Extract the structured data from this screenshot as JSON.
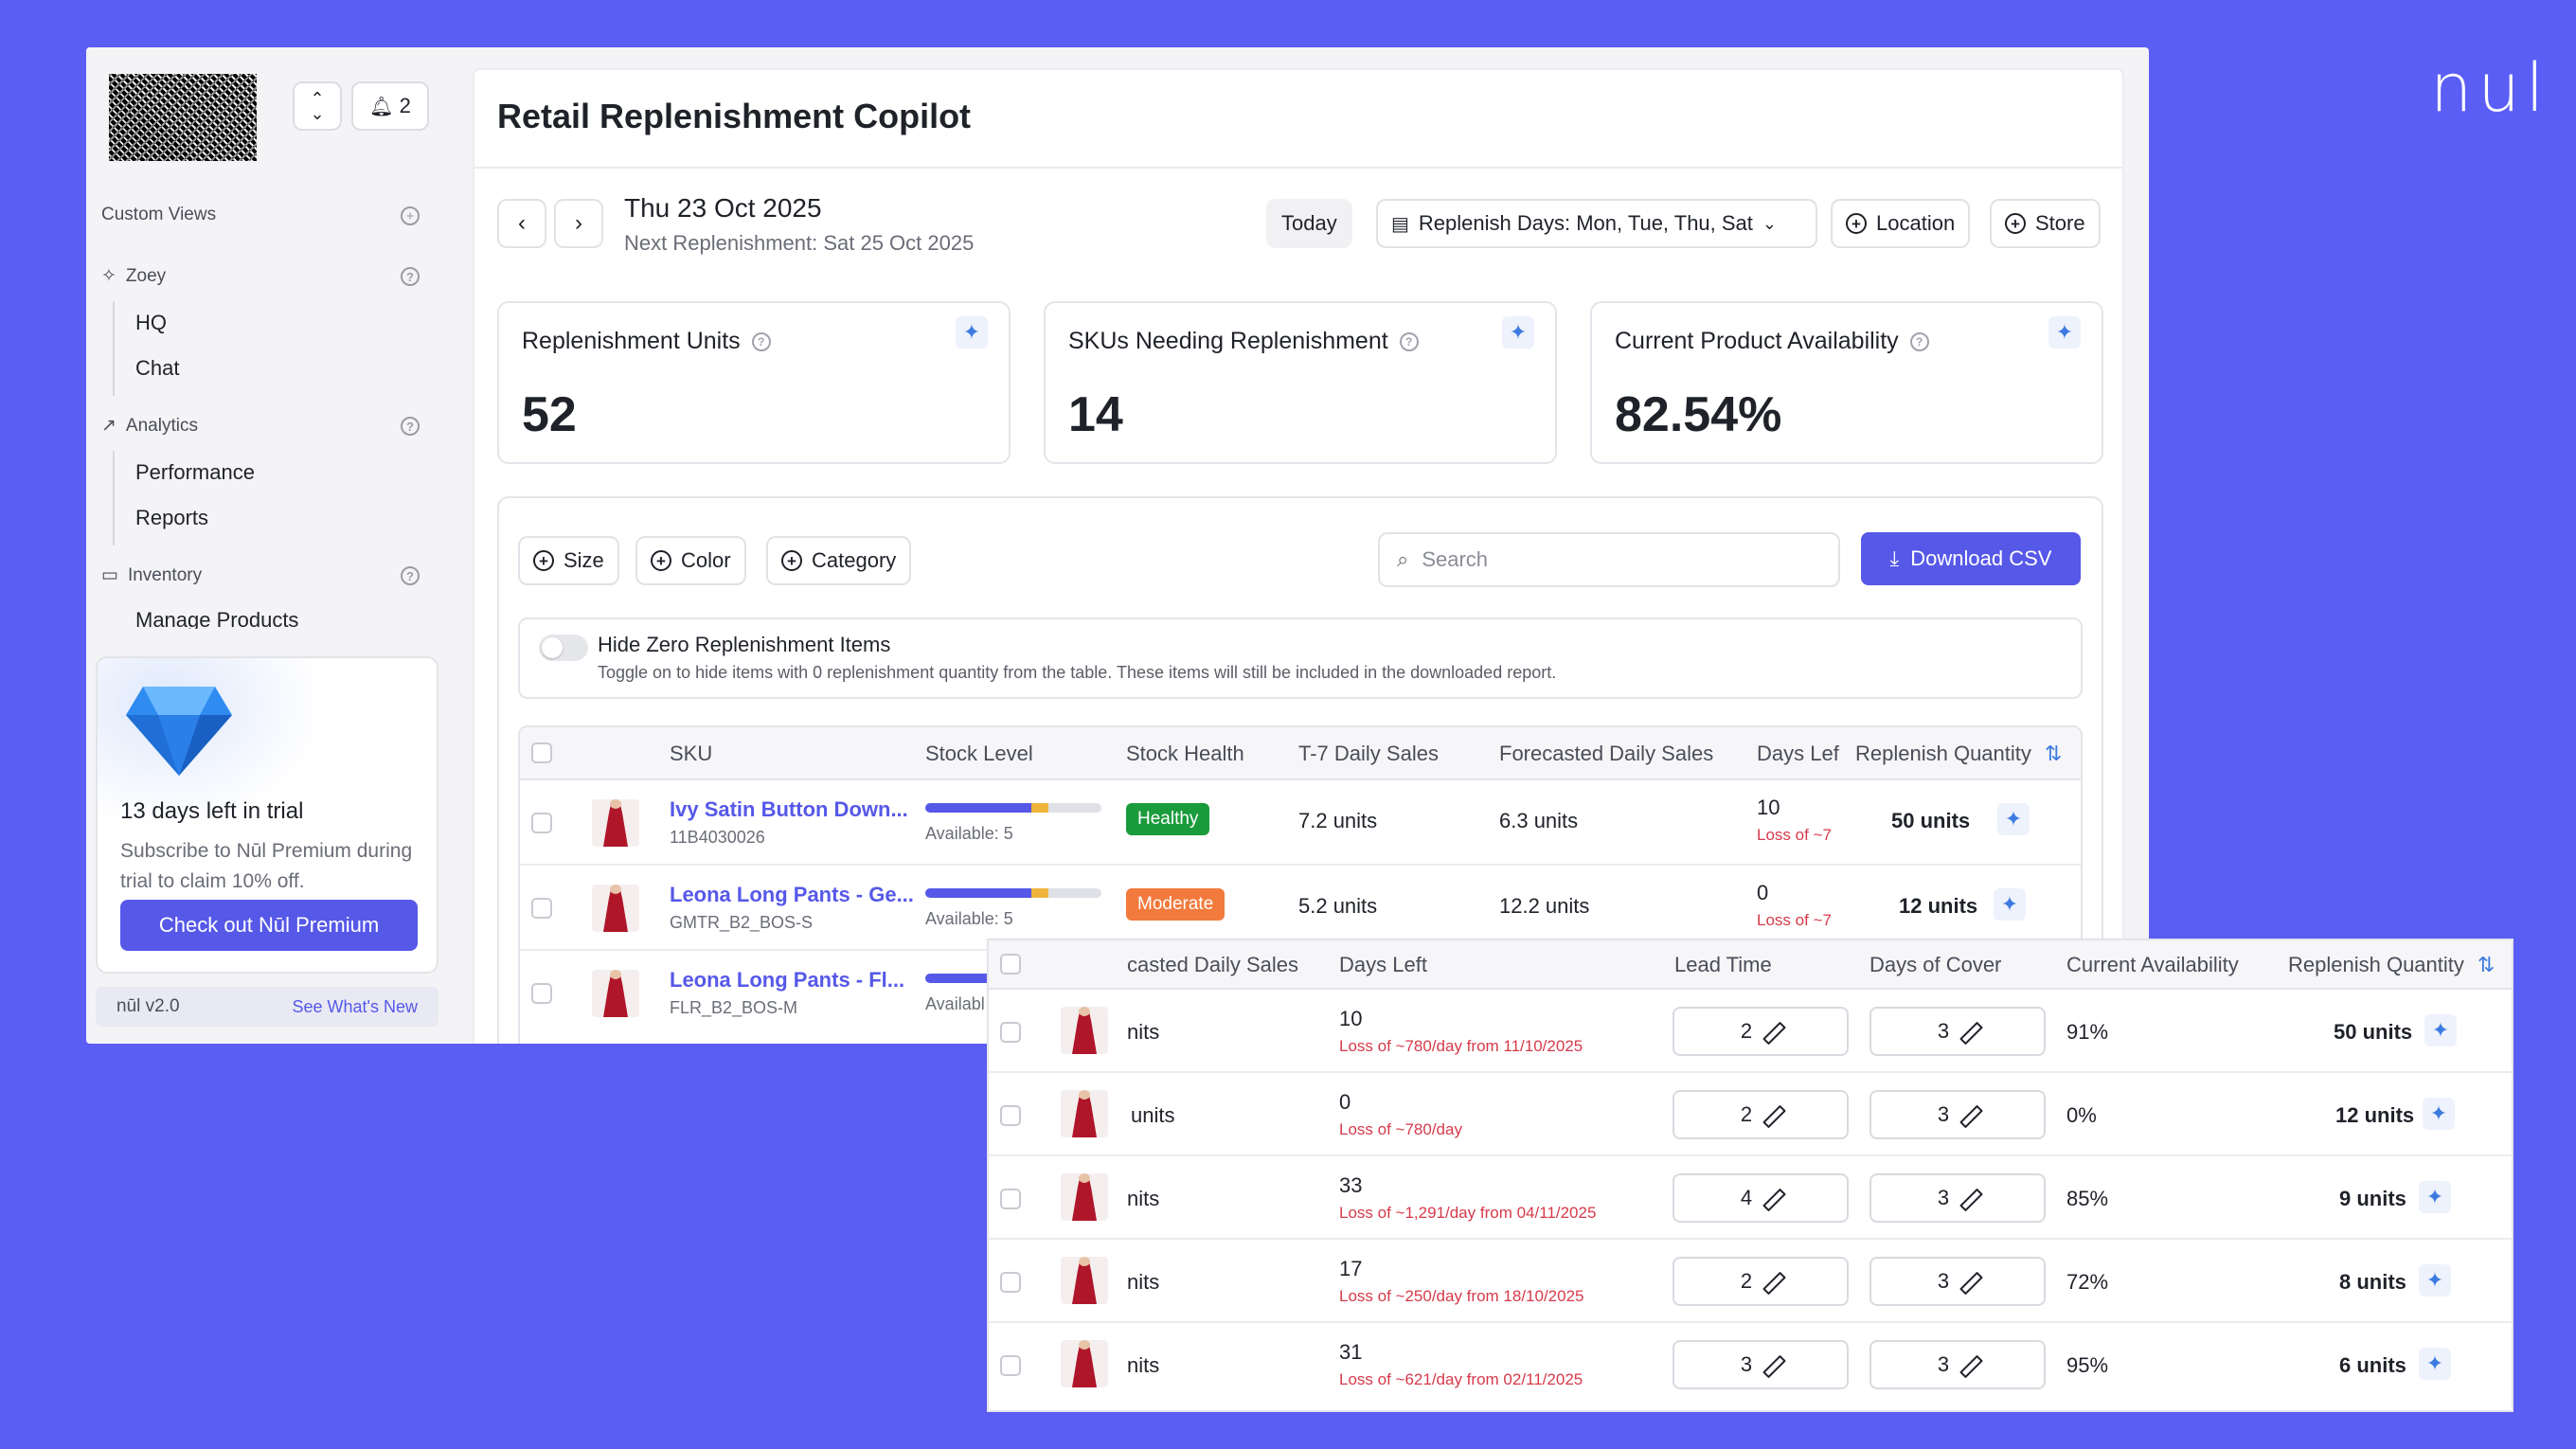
{
  "brand_mark": "nul",
  "sidebar": {
    "notification_count": "2",
    "custom_views_label": "Custom Views",
    "groups": [
      {
        "label": "Zoey",
        "items": [
          "HQ",
          "Chat"
        ]
      },
      {
        "label": "Analytics",
        "items": [
          "Performance",
          "Reports"
        ]
      },
      {
        "label": "Inventory",
        "items": [
          "Manage Products"
        ]
      }
    ],
    "trial": {
      "title": "13 days left in trial",
      "text": "Subscribe to Nūl Premium during trial to claim 10% off.",
      "button": "Check out Nūl Premium"
    },
    "version": "nūl v2.0",
    "whats_new": "See What's New"
  },
  "header": {
    "title": "Retail Replenishment Copilot",
    "date": "Thu 23 Oct 2025",
    "next_replenishment": "Next Replenishment: Sat 25 Oct 2025",
    "today_label": "Today",
    "replenish_days": "Replenish Days: Mon, Tue, Thu, Sat",
    "location_label": "Location",
    "store_label": "Store"
  },
  "kpis": [
    {
      "title": "Replenishment Units",
      "value": "52"
    },
    {
      "title": "SKUs Needing Replenishment",
      "value": "14"
    },
    {
      "title": "Current Product Availability",
      "value": "82.54%"
    }
  ],
  "filters": {
    "size": "Size",
    "color": "Color",
    "category": "Category",
    "search_placeholder": "Search",
    "download": "Download CSV"
  },
  "toggle": {
    "title": "Hide Zero Replenishment Items",
    "description": "Toggle on to hide items with 0 replenishment quantity from the table. These items will still be included in the downloaded report."
  },
  "table": {
    "columns": [
      "SKU",
      "Stock Level",
      "Stock Health",
      "T-7 Daily Sales",
      "Forecasted Daily Sales",
      "Days Lef",
      "Replenish Quantity"
    ],
    "rows": [
      {
        "name": "Ivy Satin Button Down...",
        "code": "11B4030026",
        "available": "Available: 5",
        "stock_level": 0.7,
        "health": "Healthy",
        "health_color": "#1a9b3c",
        "t7": "7.2 units",
        "forecast": "6.3 units",
        "days_left": "10",
        "loss": "Loss of ~7",
        "qty": "50 units"
      },
      {
        "name": "Leona Long Pants - Ge...",
        "code": "GMTR_B2_BOS-S",
        "available": "Available: 5",
        "stock_level": 0.7,
        "health": "Moderate",
        "health_color": "#f27a3c",
        "t7": "5.2 units",
        "forecast": "12.2 units",
        "days_left": "0",
        "loss": "Loss of ~7",
        "qty": "12 units"
      },
      {
        "name": "Leona Long Pants - Fl...",
        "code": "FLR_B2_BOS-M",
        "available": "Availabl",
        "stock_level": 0.5
      }
    ]
  },
  "overlay": {
    "columns": [
      "casted Daily Sales",
      "Days Left",
      "Lead Time",
      "Days of Cover",
      "Current Availability",
      "Replenish Quantity"
    ],
    "rows": [
      {
        "units": "nits",
        "days_left": "10",
        "loss": "Loss of ~780/day from 11/10/2025",
        "lead": "2",
        "cover": "3",
        "avail": "91%",
        "qty": "50 units"
      },
      {
        "units": "units",
        "days_left": "0",
        "loss": "Loss of ~780/day",
        "lead": "2",
        "cover": "3",
        "avail": "0%",
        "qty": "12 units"
      },
      {
        "units": "nits",
        "days_left": "33",
        "loss": "Loss of ~1,291/day from 04/11/2025",
        "lead": "4",
        "cover": "3",
        "avail": "85%",
        "qty": "9 units"
      },
      {
        "units": "nits",
        "days_left": "17",
        "loss": "Loss of ~250/day from 18/10/2025",
        "lead": "2",
        "cover": "3",
        "avail": "72%",
        "qty": "8 units"
      },
      {
        "units": "nits",
        "days_left": "31",
        "loss": "Loss of ~621/day from 02/11/2025",
        "lead": "3",
        "cover": "3",
        "avail": "95%",
        "qty": "6 units"
      }
    ]
  }
}
